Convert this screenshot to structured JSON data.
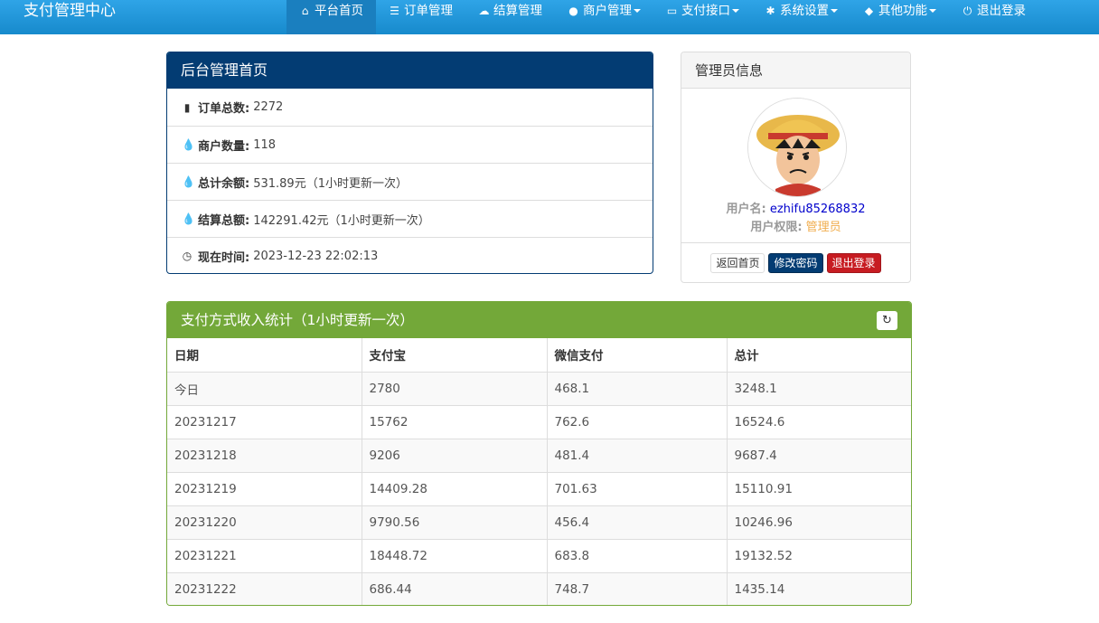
{
  "brand": "支付管理中心",
  "nav": [
    {
      "label": "平台首页",
      "icon": "home-icon",
      "glyph": "⌂",
      "active": true,
      "dropdown": false
    },
    {
      "label": "订单管理",
      "icon": "list-icon",
      "glyph": "☰",
      "active": false,
      "dropdown": false
    },
    {
      "label": "结算管理",
      "icon": "cloud-icon",
      "glyph": "☁",
      "active": false,
      "dropdown": false
    },
    {
      "label": "商户管理",
      "icon": "user-icon",
      "glyph": "●",
      "active": false,
      "dropdown": true
    },
    {
      "label": "支付接口",
      "icon": "credit-card-icon",
      "glyph": "▭",
      "active": false,
      "dropdown": true
    },
    {
      "label": "系统设置",
      "icon": "gear-icon",
      "glyph": "✱",
      "active": false,
      "dropdown": true
    },
    {
      "label": "其他功能",
      "icon": "cube-icon",
      "glyph": "◆",
      "active": false,
      "dropdown": true
    },
    {
      "label": "退出登录",
      "icon": "power-icon",
      "glyph": "⏻",
      "active": false,
      "dropdown": false
    }
  ],
  "overview": {
    "title": "后台管理首页",
    "rows": [
      {
        "icon": "bar-chart-icon",
        "glyph": "▮",
        "label": "订单总数:",
        "value": "2272"
      },
      {
        "icon": "drop-icon",
        "glyph": "💧",
        "label": "商户数量:",
        "value": "118"
      },
      {
        "icon": "drop-icon",
        "glyph": "💧",
        "label": "总计余额:",
        "value": "531.89元（1小时更新一次）"
      },
      {
        "icon": "drop-icon",
        "glyph": "💧",
        "label": "结算总额:",
        "value": "142291.42元（1小时更新一次）"
      },
      {
        "icon": "clock-icon",
        "glyph": "◷",
        "label": "现在时间:",
        "value": "2023-12-23 22:02:13"
      }
    ]
  },
  "admin": {
    "title": "管理员信息",
    "username_label": "用户名:",
    "username": "ezhifu85268832",
    "role_label": "用户权限:",
    "role": "管理员",
    "buttons": {
      "home": "返回首页",
      "password": "修改密码",
      "logout": "退出登录"
    },
    "colors": {
      "username": "#0000cc",
      "role": "#f0ad4e"
    }
  },
  "stats": {
    "title": "支付方式收入统计（1小时更新一次）",
    "columns": [
      "日期",
      "支付宝",
      "微信支付",
      "总计"
    ],
    "rows": [
      [
        "今日",
        "2780",
        "468.1",
        "3248.1"
      ],
      [
        "20231217",
        "15762",
        "762.6",
        "16524.6"
      ],
      [
        "20231218",
        "9206",
        "481.4",
        "9687.4"
      ],
      [
        "20231219",
        "14409.28",
        "701.63",
        "15110.91"
      ],
      [
        "20231220",
        "9790.56",
        "456.4",
        "10246.96"
      ],
      [
        "20231221",
        "18448.72",
        "683.8",
        "19132.52"
      ],
      [
        "20231222",
        "686.44",
        "748.7",
        "1435.14"
      ]
    ]
  },
  "colors": {
    "navbar": "#2fa4e7",
    "primary": "#033c73",
    "success": "#73a839",
    "danger": "#c71c22"
  }
}
